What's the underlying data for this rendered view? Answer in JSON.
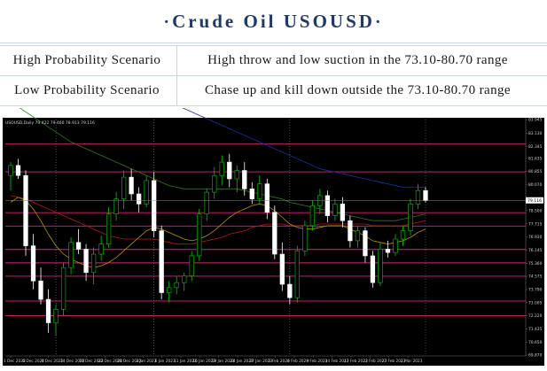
{
  "header": {
    "title": "Crude Oil USOUSD",
    "title_left_dot": "·",
    "title_right_dot": "·"
  },
  "scenarios": [
    {
      "label": "High Probability Scenario",
      "text": "High throw and low suction in the 73.10-80.70 range"
    },
    {
      "label": "Low Probability Scenario",
      "text": "Chase up and kill down outside the 73.10-80.70 range"
    }
  ],
  "chart": {
    "symbol_info": "USOUSD,Daily 79.422 79.460 78.913 79.116",
    "price_labels": [
      "83.945",
      "83.130",
      "82.345",
      "81.635",
      "80.855",
      "80.070",
      "79.116",
      "78.500",
      "77.715",
      "76.930",
      "76.145",
      "75.360",
      "74.575",
      "73.790",
      "73.005",
      "72.220",
      "71.435",
      "70.650",
      "69.870"
    ],
    "current_price": "79.116",
    "date_labels": [
      "1 Dec 2022",
      "6 Dec 2022",
      "9 Dec 2022",
      "14 Dec 2022",
      "19 Dec 2022",
      "22 Dec 2022",
      "28 Dec 2022",
      "3 Jan 2023",
      "6 Jan 2023",
      "11 Jan 2023",
      "16 Jan 2023",
      "19 Jan 2023",
      "24 Jan 2023",
      "27 Jan 2023",
      "1 Feb 2023",
      "6 Feb 2023",
      "9 Feb 2023",
      "14 Feb 2023",
      "17 Feb 2023",
      "22 Feb 2023",
      "27 Feb 2023",
      "2 Mar 2023"
    ],
    "colors": {
      "background": "#000000",
      "bull": "#00c800",
      "bear": "#ffffff",
      "level": "#d9257a",
      "ma_fast": "#b89200",
      "ma_slow": "#b21a1a",
      "ma_long": "#2d7a1e",
      "ma_longest": "#1c2f9c",
      "grid": "#6f6f6f",
      "axis_text": "#d0d0d0"
    },
    "candles": [
      {
        "o": 80.6,
        "h": 81.4,
        "l": 79.7,
        "c": 81.2
      },
      {
        "o": 81.2,
        "h": 81.6,
        "l": 80.4,
        "c": 80.6
      },
      {
        "o": 80.6,
        "h": 80.9,
        "l": 75.8,
        "c": 76.4
      },
      {
        "o": 76.4,
        "h": 77.1,
        "l": 73.8,
        "c": 74.3
      },
      {
        "o": 74.3,
        "h": 75.1,
        "l": 72.9,
        "c": 73.2
      },
      {
        "o": 73.2,
        "h": 73.8,
        "l": 71.2,
        "c": 71.8
      },
      {
        "o": 71.8,
        "h": 72.9,
        "l": 71.0,
        "c": 72.6
      },
      {
        "o": 72.6,
        "h": 75.4,
        "l": 72.2,
        "c": 75.1
      },
      {
        "o": 75.1,
        "h": 76.9,
        "l": 74.7,
        "c": 76.6
      },
      {
        "o": 76.6,
        "h": 77.4,
        "l": 75.9,
        "c": 76.2
      },
      {
        "o": 76.2,
        "h": 76.5,
        "l": 74.3,
        "c": 74.8
      },
      {
        "o": 74.8,
        "h": 76.3,
        "l": 74.1,
        "c": 75.9
      },
      {
        "o": 75.9,
        "h": 77.0,
        "l": 75.5,
        "c": 76.5
      },
      {
        "o": 76.5,
        "h": 78.7,
        "l": 76.3,
        "c": 78.3
      },
      {
        "o": 78.3,
        "h": 79.6,
        "l": 77.9,
        "c": 79.2
      },
      {
        "o": 79.2,
        "h": 80.9,
        "l": 78.6,
        "c": 80.5
      },
      {
        "o": 80.5,
        "h": 81.0,
        "l": 79.1,
        "c": 79.5
      },
      {
        "o": 79.5,
        "h": 79.9,
        "l": 78.4,
        "c": 78.9
      },
      {
        "o": 78.9,
        "h": 80.6,
        "l": 78.7,
        "c": 80.3
      },
      {
        "o": 80.3,
        "h": 80.8,
        "l": 76.9,
        "c": 77.3
      },
      {
        "o": 77.3,
        "h": 77.6,
        "l": 73.2,
        "c": 73.6
      },
      {
        "o": 73.6,
        "h": 74.3,
        "l": 73.0,
        "c": 73.9
      },
      {
        "o": 73.9,
        "h": 74.6,
        "l": 73.5,
        "c": 74.2
      },
      {
        "o": 74.2,
        "h": 74.8,
        "l": 73.7,
        "c": 74.6
      },
      {
        "o": 74.6,
        "h": 76.1,
        "l": 74.3,
        "c": 75.8
      },
      {
        "o": 75.8,
        "h": 78.6,
        "l": 75.5,
        "c": 78.3
      },
      {
        "o": 78.3,
        "h": 79.8,
        "l": 77.9,
        "c": 79.6
      },
      {
        "o": 79.6,
        "h": 81.1,
        "l": 79.2,
        "c": 80.6
      },
      {
        "o": 80.6,
        "h": 81.8,
        "l": 80.0,
        "c": 81.4
      },
      {
        "o": 81.4,
        "h": 81.9,
        "l": 79.9,
        "c": 80.4
      },
      {
        "o": 80.4,
        "h": 81.2,
        "l": 79.6,
        "c": 80.9
      },
      {
        "o": 80.9,
        "h": 81.4,
        "l": 79.4,
        "c": 79.8
      },
      {
        "o": 79.8,
        "h": 80.2,
        "l": 78.9,
        "c": 79.2
      },
      {
        "o": 79.2,
        "h": 80.6,
        "l": 78.9,
        "c": 80.1
      },
      {
        "o": 80.1,
        "h": 80.4,
        "l": 78.0,
        "c": 78.4
      },
      {
        "o": 78.4,
        "h": 78.8,
        "l": 75.6,
        "c": 75.9
      },
      {
        "o": 75.9,
        "h": 76.6,
        "l": 73.7,
        "c": 74.1
      },
      {
        "o": 74.1,
        "h": 74.6,
        "l": 72.9,
        "c": 73.3
      },
      {
        "o": 73.3,
        "h": 76.4,
        "l": 73.0,
        "c": 76.1
      },
      {
        "o": 76.1,
        "h": 77.9,
        "l": 75.8,
        "c": 77.6
      },
      {
        "o": 77.6,
        "h": 79.1,
        "l": 77.3,
        "c": 78.8
      },
      {
        "o": 78.8,
        "h": 79.8,
        "l": 78.3,
        "c": 79.4
      },
      {
        "o": 79.4,
        "h": 79.7,
        "l": 77.8,
        "c": 78.2
      },
      {
        "o": 78.2,
        "h": 79.2,
        "l": 77.9,
        "c": 78.9
      },
      {
        "o": 78.9,
        "h": 79.3,
        "l": 77.5,
        "c": 77.9
      },
      {
        "o": 77.9,
        "h": 78.2,
        "l": 76.3,
        "c": 76.7
      },
      {
        "o": 76.7,
        "h": 77.6,
        "l": 76.3,
        "c": 77.3
      },
      {
        "o": 77.3,
        "h": 77.5,
        "l": 75.4,
        "c": 75.8
      },
      {
        "o": 75.8,
        "h": 76.1,
        "l": 73.9,
        "c": 74.2
      },
      {
        "o": 74.2,
        "h": 76.6,
        "l": 74.0,
        "c": 76.2
      },
      {
        "o": 76.2,
        "h": 76.7,
        "l": 75.7,
        "c": 76.0
      },
      {
        "o": 76.0,
        "h": 77.1,
        "l": 75.8,
        "c": 76.8
      },
      {
        "o": 76.8,
        "h": 77.6,
        "l": 76.4,
        "c": 77.3
      },
      {
        "o": 77.3,
        "h": 79.2,
        "l": 77.0,
        "c": 78.9
      },
      {
        "o": 78.9,
        "h": 80.1,
        "l": 78.6,
        "c": 79.7
      },
      {
        "o": 79.7,
        "h": 79.9,
        "l": 79.0,
        "c": 79.1
      }
    ],
    "levels": [
      82.48,
      80.82,
      78.38,
      77.58,
      76.18,
      75.38,
      74.58,
      73.1,
      72.22
    ],
    "vlines_at_candle": [
      6,
      19,
      37,
      55
    ],
    "ma_fast": [
      79.0,
      79.3,
      79.1,
      78.6,
      77.9,
      77.1,
      76.4,
      75.9,
      75.6,
      75.4,
      75.2,
      75.1,
      75.2,
      75.4,
      75.7,
      76.1,
      76.5,
      76.9,
      77.3,
      77.5,
      77.4,
      77.2,
      77.0,
      76.8,
      76.7,
      76.8,
      77.0,
      77.3,
      77.7,
      78.1,
      78.4,
      78.6,
      78.8,
      78.9,
      78.8,
      78.5,
      78.1,
      77.7,
      77.5,
      77.4,
      77.4,
      77.5,
      77.6,
      77.6,
      77.6,
      77.4,
      77.2,
      77.0,
      76.7,
      76.6,
      76.5,
      76.6,
      76.7,
      76.9,
      77.2,
      77.4
    ],
    "ma_slow": [
      79.4,
      79.3,
      79.2,
      79.0,
      78.8,
      78.6,
      78.4,
      78.2,
      78.0,
      77.8,
      77.6,
      77.4,
      77.2,
      77.0,
      76.9,
      76.8,
      76.8,
      76.8,
      76.8,
      76.8,
      76.7,
      76.6,
      76.5,
      76.5,
      76.5,
      76.6,
      76.7,
      76.8,
      76.9,
      77.1,
      77.2,
      77.3,
      77.5,
      77.6,
      77.7,
      77.7,
      77.7,
      77.6,
      77.6,
      77.6,
      77.6,
      77.7,
      77.7,
      77.7,
      77.7,
      77.7,
      77.7,
      77.7,
      77.6,
      77.6,
      77.6,
      77.6,
      77.6,
      77.7,
      77.8,
      77.9
    ],
    "ma_long": [
      85.0,
      84.7,
      84.4,
      84.1,
      83.8,
      83.5,
      83.2,
      82.9,
      82.6,
      82.4,
      82.2,
      82.0,
      81.8,
      81.6,
      81.4,
      81.2,
      81.0,
      80.8,
      80.6,
      80.4,
      80.2,
      80.0,
      79.9,
      79.8,
      79.8,
      79.8,
      79.8,
      79.8,
      79.8,
      79.8,
      79.8,
      79.7,
      79.6,
      79.5,
      79.4,
      79.3,
      79.2,
      79.0,
      78.9,
      78.8,
      78.7,
      78.6,
      78.5,
      78.4,
      78.3,
      78.2,
      78.1,
      78.0,
      77.9,
      77.9,
      77.9,
      77.9,
      78.0,
      78.1,
      78.2,
      78.3
    ],
    "ma_longest": [
      88.5,
      88.4,
      88.3,
      88.2,
      88.1,
      88.0,
      87.9,
      87.8,
      87.6,
      87.4,
      87.2,
      87.0,
      86.8,
      86.6,
      86.4,
      86.2,
      86.0,
      85.8,
      85.6,
      85.4,
      85.2,
      85.0,
      84.8,
      84.6,
      84.4,
      84.2,
      84.0,
      83.8,
      83.6,
      83.4,
      83.2,
      83.0,
      82.8,
      82.6,
      82.4,
      82.2,
      82.0,
      81.8,
      81.6,
      81.4,
      81.2,
      81.0,
      80.9,
      80.8,
      80.7,
      80.6,
      80.5,
      80.4,
      80.3,
      80.2,
      80.1,
      80.0,
      79.9,
      79.9,
      79.9,
      79.9
    ]
  }
}
